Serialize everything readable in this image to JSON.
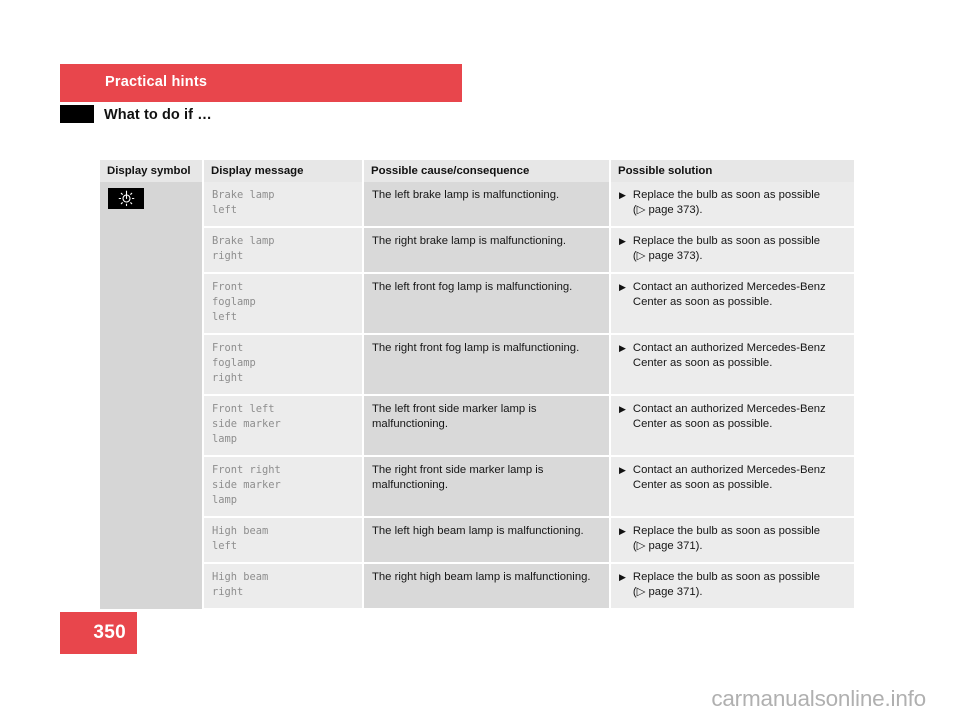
{
  "header": {
    "chapter": "Practical hints",
    "section": "What to do if …"
  },
  "table": {
    "columns": [
      "Display symbol",
      "Display message",
      "Possible cause/consequence",
      "Possible solution"
    ],
    "symbol": {
      "icon": "lamp-failure-icon",
      "background": "#000000",
      "glyph": "#ffffff"
    },
    "rows": [
      {
        "message": "Brake lamp\nleft",
        "cause": "The left brake lamp is malfunctioning.",
        "solution": "Replace the bulb as soon as possible",
        "reference": "(▷ page 373)."
      },
      {
        "message": "Brake lamp\nright",
        "cause": "The right brake lamp is malfunctioning.",
        "solution": "Replace the bulb as soon as possible",
        "reference": "(▷ page 373)."
      },
      {
        "message": "Front\nfoglamp\nleft",
        "cause": "The left front fog lamp is malfunctioning.",
        "solution": "Contact an authorized Mercedes-Benz Center as soon as possible.",
        "reference": ""
      },
      {
        "message": "Front\nfoglamp\nright",
        "cause": "The right front fog lamp is malfunctioning.",
        "solution": "Contact an authorized Mercedes-Benz Center as soon as possible.",
        "reference": ""
      },
      {
        "message": "Front left\nside marker\nlamp",
        "cause": "The left front side marker lamp is malfunctioning.",
        "solution": "Contact an authorized Mercedes-Benz Center as soon as possible.",
        "reference": ""
      },
      {
        "message": "Front right\nside marker\nlamp",
        "cause": "The right front side marker lamp is malfunctioning.",
        "solution": "Contact an authorized Mercedes-Benz Center as soon as possible.",
        "reference": ""
      },
      {
        "message": "High beam\nleft",
        "cause": "The left high beam lamp is malfunctioning.",
        "solution": "Replace the bulb as soon as possible",
        "reference": "(▷ page 371)."
      },
      {
        "message": "High beam\nright",
        "cause": "The right high beam lamp is malfunctioning.",
        "solution": "Replace the bulb as soon as possible",
        "reference": "(▷ page 371)."
      }
    ],
    "bullet": "▶"
  },
  "footer": {
    "page_number": "350",
    "watermark": "carmanualsonline.info"
  },
  "colors": {
    "accent_red": "#e8464c",
    "header_row": "#e7e7e7",
    "symbol_column": "#d6d6d6",
    "light_cell": "#ececec",
    "dark_cell": "#d9d9d9"
  }
}
